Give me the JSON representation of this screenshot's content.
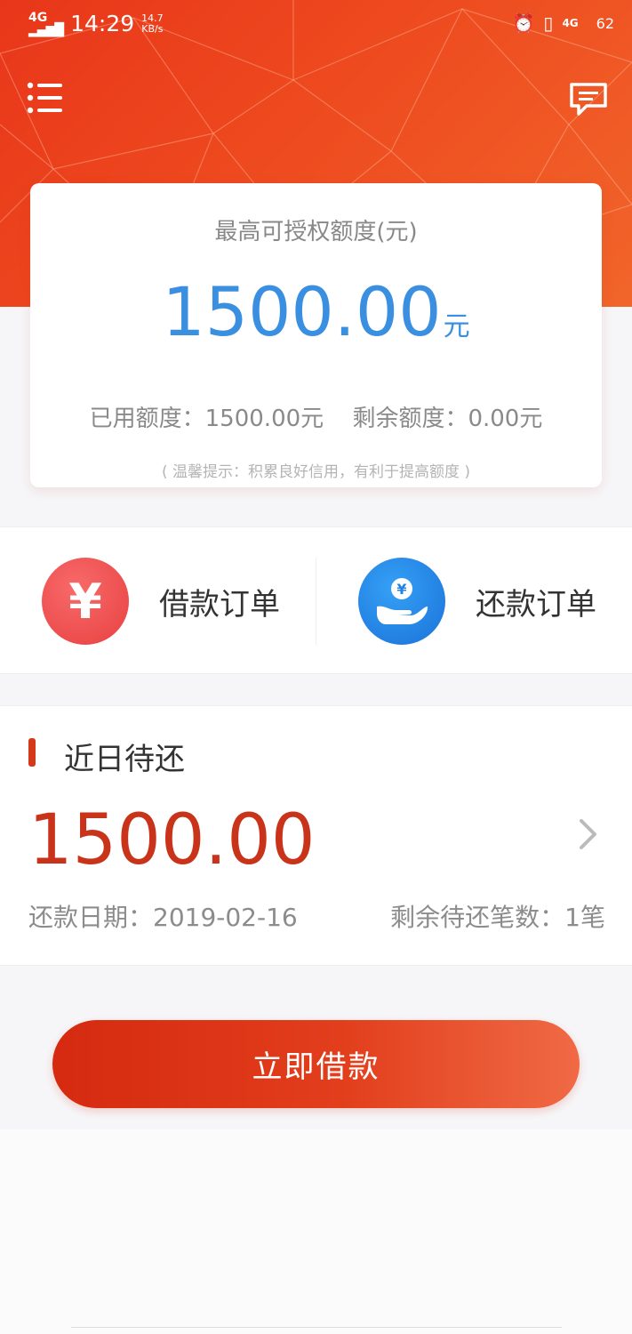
{
  "status_bar": {
    "network_type": "4G",
    "time": "14:29",
    "speed_value": "14.7",
    "speed_unit": "KB/s",
    "right_network": "4G",
    "battery": "62",
    "icons": [
      "signal-icon",
      "alarm-icon",
      "vibrate-icon",
      "network-icon",
      "battery-icon"
    ]
  },
  "header": {
    "menu_icon": "list-menu-icon",
    "message_icon": "message-icon"
  },
  "quota_card": {
    "title": "最高可授权额度(元)",
    "amount": "1500.00",
    "amount_unit": "元",
    "used_label": "已用额度：1500.00元",
    "remaining_label": "剩余额度：0.00元",
    "tip": "( 温馨提示：积累良好信用，有利于提高额度 )"
  },
  "orders": {
    "borrow_label": "借款订单",
    "borrow_icon_text": "¥",
    "repay_label": "还款订单",
    "repay_icon_text": "¥"
  },
  "recent": {
    "title": "近日待还",
    "amount": "1500.00",
    "date_label": "还款日期：2019-02-16",
    "count_label": "剩余待还笔数：1笔"
  },
  "action": {
    "borrow_now": "立即借款"
  },
  "colors": {
    "brand_red": "#e8361a",
    "amount_blue": "#3b8fe0",
    "amount_red": "#c9331a"
  }
}
